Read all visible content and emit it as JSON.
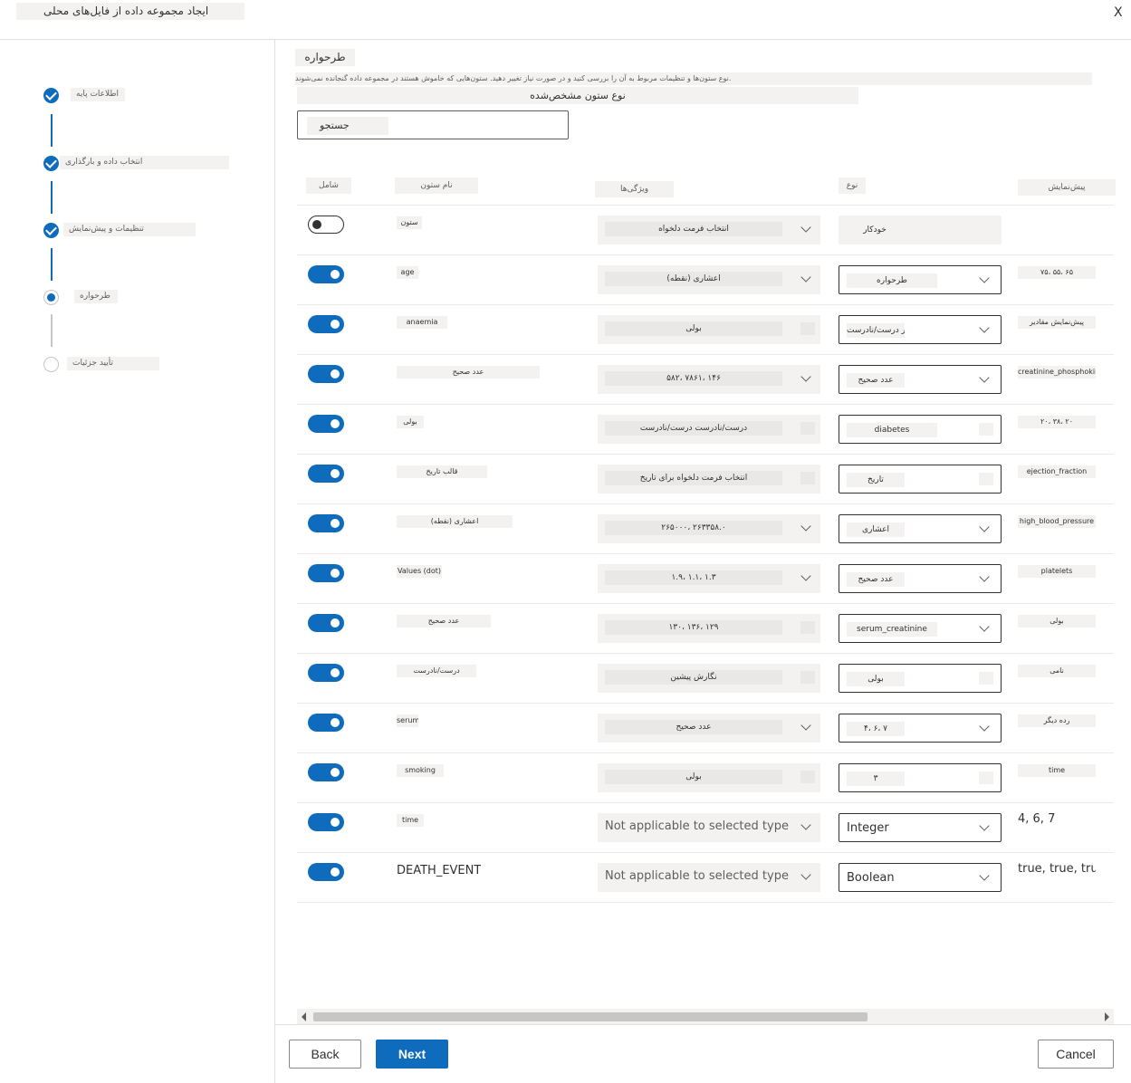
{
  "header": {
    "title": "ایجاد مجموعه داده از فایل‌های محلی",
    "close_label": "X"
  },
  "steps": [
    {
      "label": "اطلاعات پایه",
      "state": "done"
    },
    {
      "label": "انتخاب داده و بارگذاری",
      "state": "done"
    },
    {
      "label": "تنظیمات و پیش‌نمایش",
      "state": "done"
    },
    {
      "label": "طرحواره",
      "state": "current"
    },
    {
      "label": "تأیید جزئیات",
      "state": "todo"
    }
  ],
  "main": {
    "section_title": "طرحواره",
    "description": "نوع ستون‌ها و تنظیمات مربوط به آن را بررسی کنید و در صورت نیاز تغییر دهید. ستون‌هایی که خاموش هستند در مجموعه داده گنجانده نمی‌شوند.",
    "instruction": "نوع ستون مشخص‌شده",
    "search_placeholder": "جستجو",
    "columns": {
      "include": "شامل",
      "column_name": "نام ستون",
      "properties": "ویژگی‌ها",
      "type": "نوع",
      "preview": "پیش‌نمایش"
    },
    "rows": [
      {
        "on": false,
        "name": "ستون",
        "props": "انتخاب فرمت دلخواه",
        "type": "خودکار",
        "preview": "",
        "props_kind": "dd",
        "type_kind": "plain"
      },
      {
        "on": true,
        "name": "age",
        "props": "اعشاری (نقطه)",
        "type": "طرحواره",
        "preview": "۷۵، ۵۵، ۶۵",
        "props_kind": "dd",
        "type_kind": "dd"
      },
      {
        "on": true,
        "name": "anaemia",
        "props": "بولی",
        "type": "مقدار درست/نادرست",
        "preview": "پیش‌نمایش مقادیر",
        "props_kind": "sm",
        "type_kind": "dd"
      },
      {
        "on": true,
        "name": "عدد صحیح",
        "props": "۵۸۲، ۷۸۶۱، ۱۴۶",
        "type": "عدد صحیح",
        "preview": "creatinine_phosphokinase",
        "props_kind": "dd",
        "type_kind": "dd"
      },
      {
        "on": true,
        "name": "بولی",
        "props": "درست/نادرست درست/نادرست",
        "type": "diabetes",
        "preview": "۲۰، ۳۸، ۲۰",
        "props_kind": "sm",
        "type_kind": "sm"
      },
      {
        "on": true,
        "name": "قالب تاریخ",
        "props": "انتخاب فرمت دلخواه برای تاریخ",
        "type": "تاریخ",
        "preview": "ejection_fraction",
        "props_kind": "sm",
        "type_kind": "sm"
      },
      {
        "on": true,
        "name": "اعشاری (نقطه)",
        "props": "۲۶۵۰۰۰، ۲۶۳۳۵۸.۰",
        "type": "اعشاری",
        "preview": "high_blood_pressure",
        "props_kind": "dd",
        "type_kind": "dd"
      },
      {
        "on": true,
        "name": "Values (dot)",
        "props": "۱.۹، ۱.۱، ۱.۳",
        "type": "عدد صحیح",
        "preview": "platelets",
        "props_kind": "dd",
        "type_kind": "dd"
      },
      {
        "on": true,
        "name": "عدد صحیح",
        "props": "۱۳۰، ۱۳۶، ۱۲۹",
        "type": "serum_creatinine",
        "preview": "بولی",
        "props_kind": "sm",
        "type_kind": "dd"
      },
      {
        "on": true,
        "name": "درست/نادرست",
        "props": "نگارش پیشین",
        "type": "بولی",
        "preview": "نامی",
        "props_kind": "sm",
        "type_kind": "sm"
      },
      {
        "on": true,
        "name": "serum",
        "props": "عدد صحیح",
        "type": "۴، ۶، ۷",
        "preview": "رده دیگر",
        "props_kind": "dd",
        "type_kind": "dd"
      },
      {
        "on": true,
        "name": "smoking",
        "props": "بولی",
        "type": "۳",
        "preview": "time",
        "props_kind": "sm",
        "type_kind": "sm"
      },
      {
        "on": true,
        "name": "time",
        "props": "Not applicable to selected type",
        "type": "Integer",
        "preview": "4, 6, 7",
        "props_kind": "real",
        "type_kind": "real"
      },
      {
        "on": true,
        "name": "DEATH_EVENT",
        "props": "Not applicable to selected type",
        "type": "Boolean",
        "preview": "true, true, true",
        "props_kind": "real",
        "type_kind": "real"
      }
    ]
  },
  "footer": {
    "back_label": "Back",
    "next_label": "Next",
    "cancel_label": "Cancel"
  },
  "colors": {
    "accent": "#0f6cbd",
    "placeholder_block": "#f3f2f1",
    "border": "#e1dfdd"
  }
}
